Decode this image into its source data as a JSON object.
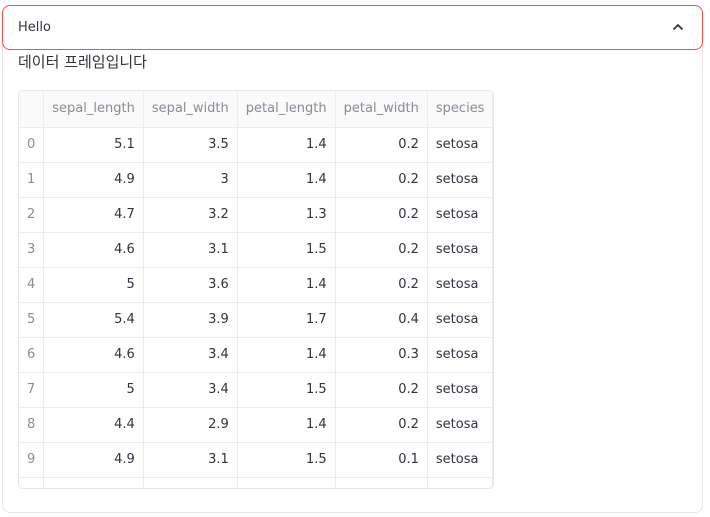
{
  "expander": {
    "title": "Hello"
  },
  "caption": "데이터 프레임입니다",
  "table": {
    "columns": [
      "",
      "sepal_length",
      "sepal_width",
      "petal_length",
      "petal_width",
      "species"
    ],
    "rows": [
      [
        "0",
        "5.1",
        "3.5",
        "1.4",
        "0.2",
        "setosa"
      ],
      [
        "1",
        "4.9",
        "3",
        "1.4",
        "0.2",
        "setosa"
      ],
      [
        "2",
        "4.7",
        "3.2",
        "1.3",
        "0.2",
        "setosa"
      ],
      [
        "3",
        "4.6",
        "3.1",
        "1.5",
        "0.2",
        "setosa"
      ],
      [
        "4",
        "5",
        "3.6",
        "1.4",
        "0.2",
        "setosa"
      ],
      [
        "5",
        "5.4",
        "3.9",
        "1.7",
        "0.4",
        "setosa"
      ],
      [
        "6",
        "4.6",
        "3.4",
        "1.4",
        "0.3",
        "setosa"
      ],
      [
        "7",
        "5",
        "3.4",
        "1.5",
        "0.2",
        "setosa"
      ],
      [
        "8",
        "4.4",
        "2.9",
        "1.4",
        "0.2",
        "setosa"
      ],
      [
        "9",
        "4.9",
        "3.1",
        "1.5",
        "0.1",
        "setosa"
      ]
    ]
  },
  "colors": {
    "accent": "#ff4b4b",
    "border": "#e6e6ea",
    "muted_text": "#8a8d97"
  },
  "icons": {
    "expander_toggle": "chevron-up-icon"
  }
}
